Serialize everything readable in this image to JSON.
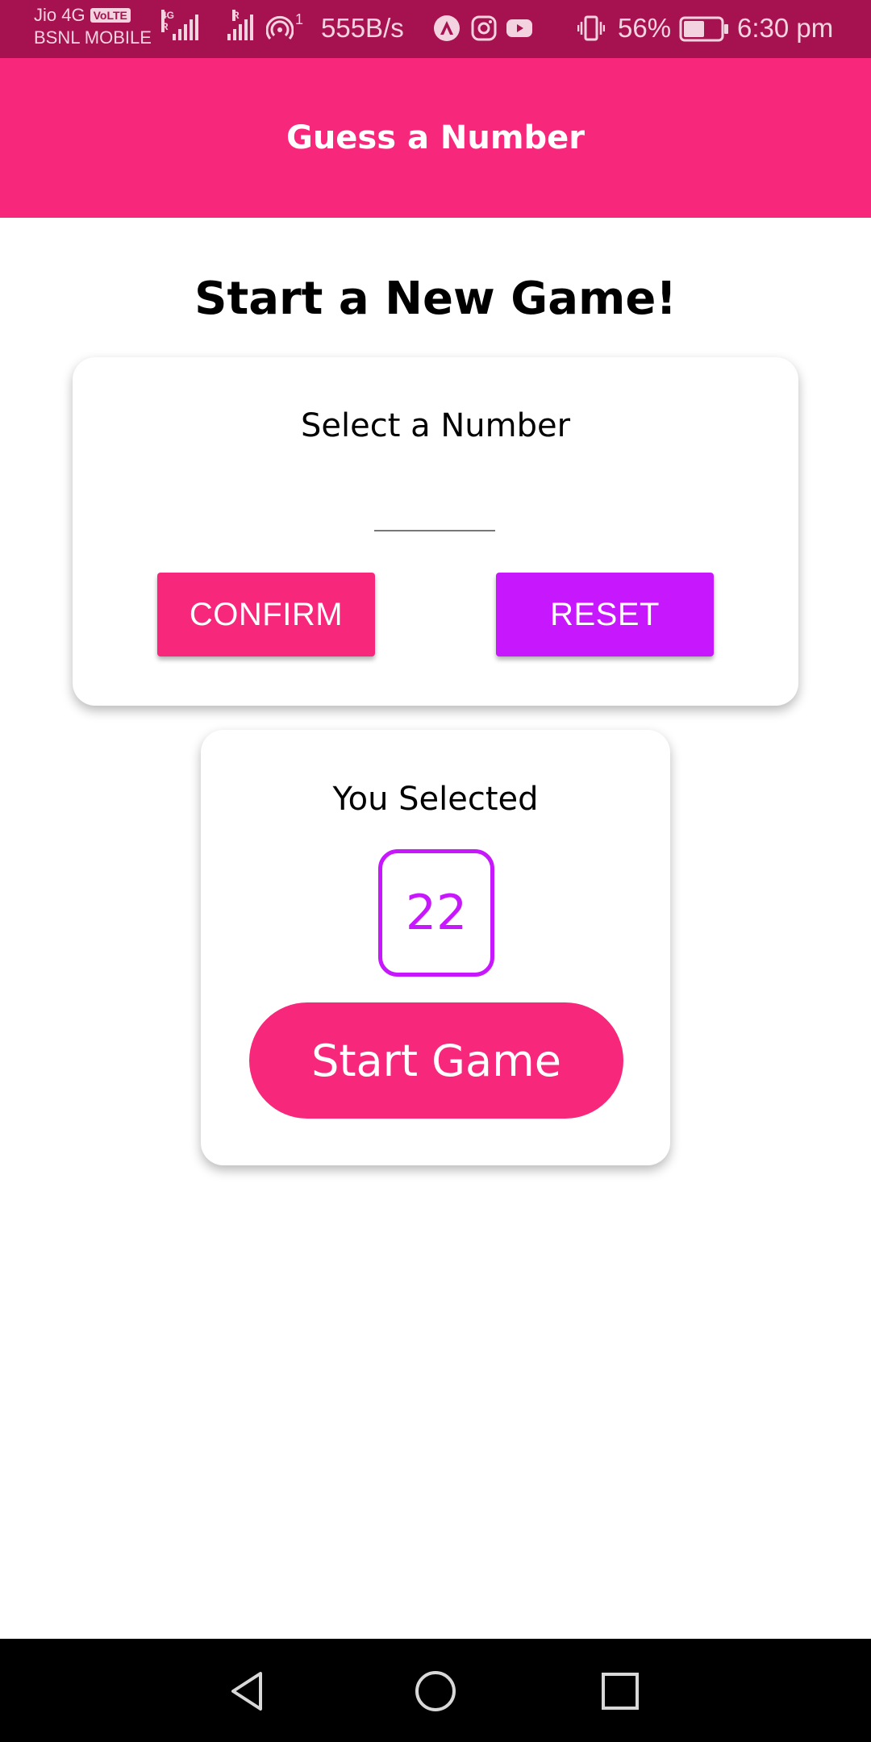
{
  "status_bar": {
    "carrier_1": "Jio 4G",
    "volte_badge": "VoLTE",
    "carrier_2": "BSNL MOBILE",
    "network_tag": "4G R",
    "roaming_tag": "R",
    "hotspot_count": "1",
    "data_speed": "555B/s",
    "battery_percent": "56%",
    "battery_level": 0.56,
    "time": "6:30 pm"
  },
  "header": {
    "title": "Guess a Number"
  },
  "main": {
    "heading": "Start a New Game!",
    "input_card": {
      "label": "Select a Number",
      "input_value": "",
      "confirm_label": "CONFIRM",
      "reset_label": "RESET"
    },
    "selected_card": {
      "label": "You Selected",
      "selected_number": "22",
      "start_label": "Start Game"
    }
  },
  "colors": {
    "primary": "#f7287b",
    "accent": "#c717fc",
    "status_bar": "#a6124f"
  },
  "nav": {
    "icons": [
      "back-icon",
      "home-icon",
      "recents-icon"
    ]
  }
}
